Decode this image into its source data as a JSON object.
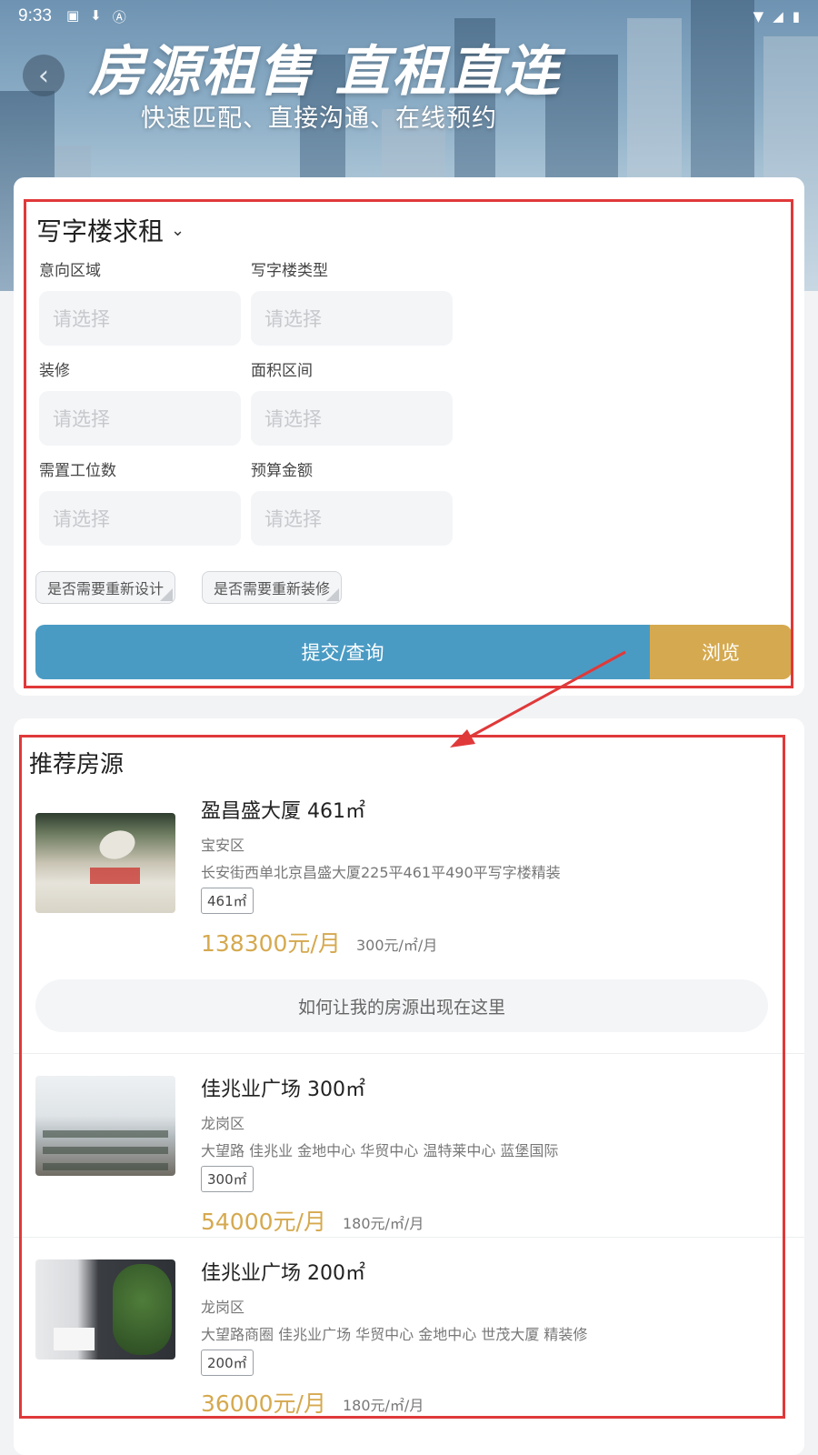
{
  "status_bar": {
    "time": "9:33"
  },
  "hero": {
    "title": "房源租售  直租直连",
    "subtitle": "快速匹配、直接沟通、在线预约"
  },
  "form": {
    "title": "写字楼求租",
    "fields": [
      {
        "label": "意向区域",
        "placeholder": "请选择"
      },
      {
        "label": "写字楼类型",
        "placeholder": "请选择"
      },
      {
        "label": "装修",
        "placeholder": "请选择"
      },
      {
        "label": "面积区间",
        "placeholder": "请选择"
      },
      {
        "label": "需置工位数",
        "placeholder": "请选择"
      },
      {
        "label": "预算金额",
        "placeholder": "请选择"
      }
    ],
    "options": [
      "是否需要重新设计",
      "是否需要重新装修"
    ],
    "submit_label": "提交/查询",
    "browse_label": "浏览"
  },
  "listings": {
    "title": "推荐房源",
    "how_label": "如何让我的房源出现在这里",
    "items": [
      {
        "name": "盈昌盛大厦 461㎡",
        "district": "宝安区",
        "desc": "长安街西单北京昌盛大厦225平461平490平写字楼精装",
        "area": "461㎡",
        "price": "138300元/月",
        "unit_price": "300元/㎡/月"
      },
      {
        "name": "佳兆业广场 300㎡",
        "district": "龙岗区",
        "desc": "大望路 佳兆业 金地中心 华贸中心 温特莱中心 蓝堡国际",
        "area": "300㎡",
        "price": "54000元/月",
        "unit_price": "180元/㎡/月"
      },
      {
        "name": "佳兆业广场 200㎡",
        "district": "龙岗区",
        "desc": "大望路商圈 佳兆业广场 华贸中心 金地中心 世茂大厦 精装修",
        "area": "200㎡",
        "price": "36000元/月",
        "unit_price": "180元/㎡/月"
      }
    ]
  },
  "colors": {
    "primary": "#4a9bc4",
    "accent": "#d5a94f",
    "annotation": "#e0393a"
  }
}
